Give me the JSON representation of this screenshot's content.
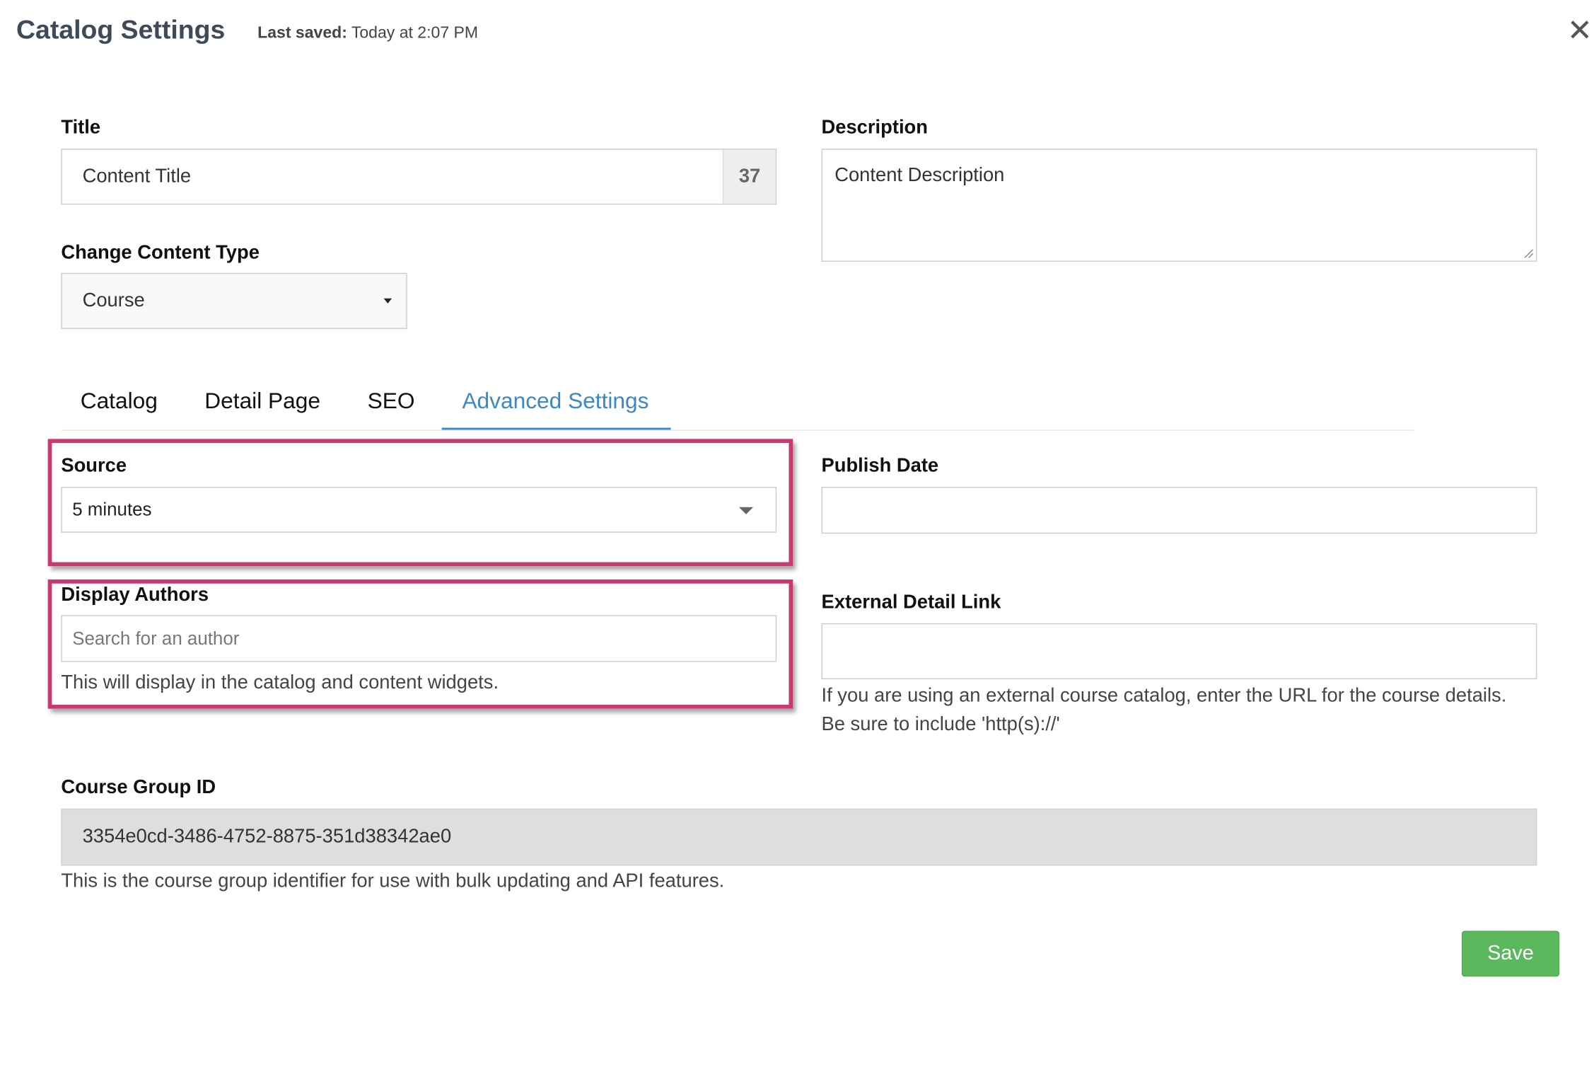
{
  "header": {
    "title": "Catalog Settings",
    "last_saved_label": "Last saved:",
    "last_saved_value": "Today at 2:07 PM",
    "close_icon": "close-icon",
    "close_glyph": "✕"
  },
  "form": {
    "title": {
      "label": "Title",
      "value": "Content Title",
      "char_count": "37"
    },
    "description": {
      "label": "Description",
      "value": "Content Description"
    },
    "content_type": {
      "label": "Change Content Type",
      "selected": "Course"
    }
  },
  "tabs": [
    {
      "label": "Catalog",
      "active": false
    },
    {
      "label": "Detail Page",
      "active": false
    },
    {
      "label": "SEO",
      "active": false
    },
    {
      "label": "Advanced Settings",
      "active": true
    }
  ],
  "advanced": {
    "source": {
      "label": "Source",
      "selected": "5 minutes"
    },
    "publish_date": {
      "label": "Publish Date",
      "value": ""
    },
    "display_authors": {
      "label": "Display Authors",
      "placeholder": "Search for an author",
      "help": "This will display in the catalog and content widgets."
    },
    "external_link": {
      "label": "External Detail Link",
      "value": "",
      "help_line1": "If you are using an external course catalog, enter the URL for the course details.",
      "help_line2": "Be sure to include 'http(s)://'"
    },
    "course_group_id": {
      "label": "Course Group ID",
      "value": "3354e0cd-3486-4752-8875-351d38342ae0",
      "help": "This is the course group identifier for use with bulk updating and API features."
    }
  },
  "actions": {
    "save_label": "Save"
  },
  "colors": {
    "accent": "#3a89c4",
    "highlight": "#c83a72",
    "save": "#5cb85c",
    "title_text": "#3d4a57"
  }
}
